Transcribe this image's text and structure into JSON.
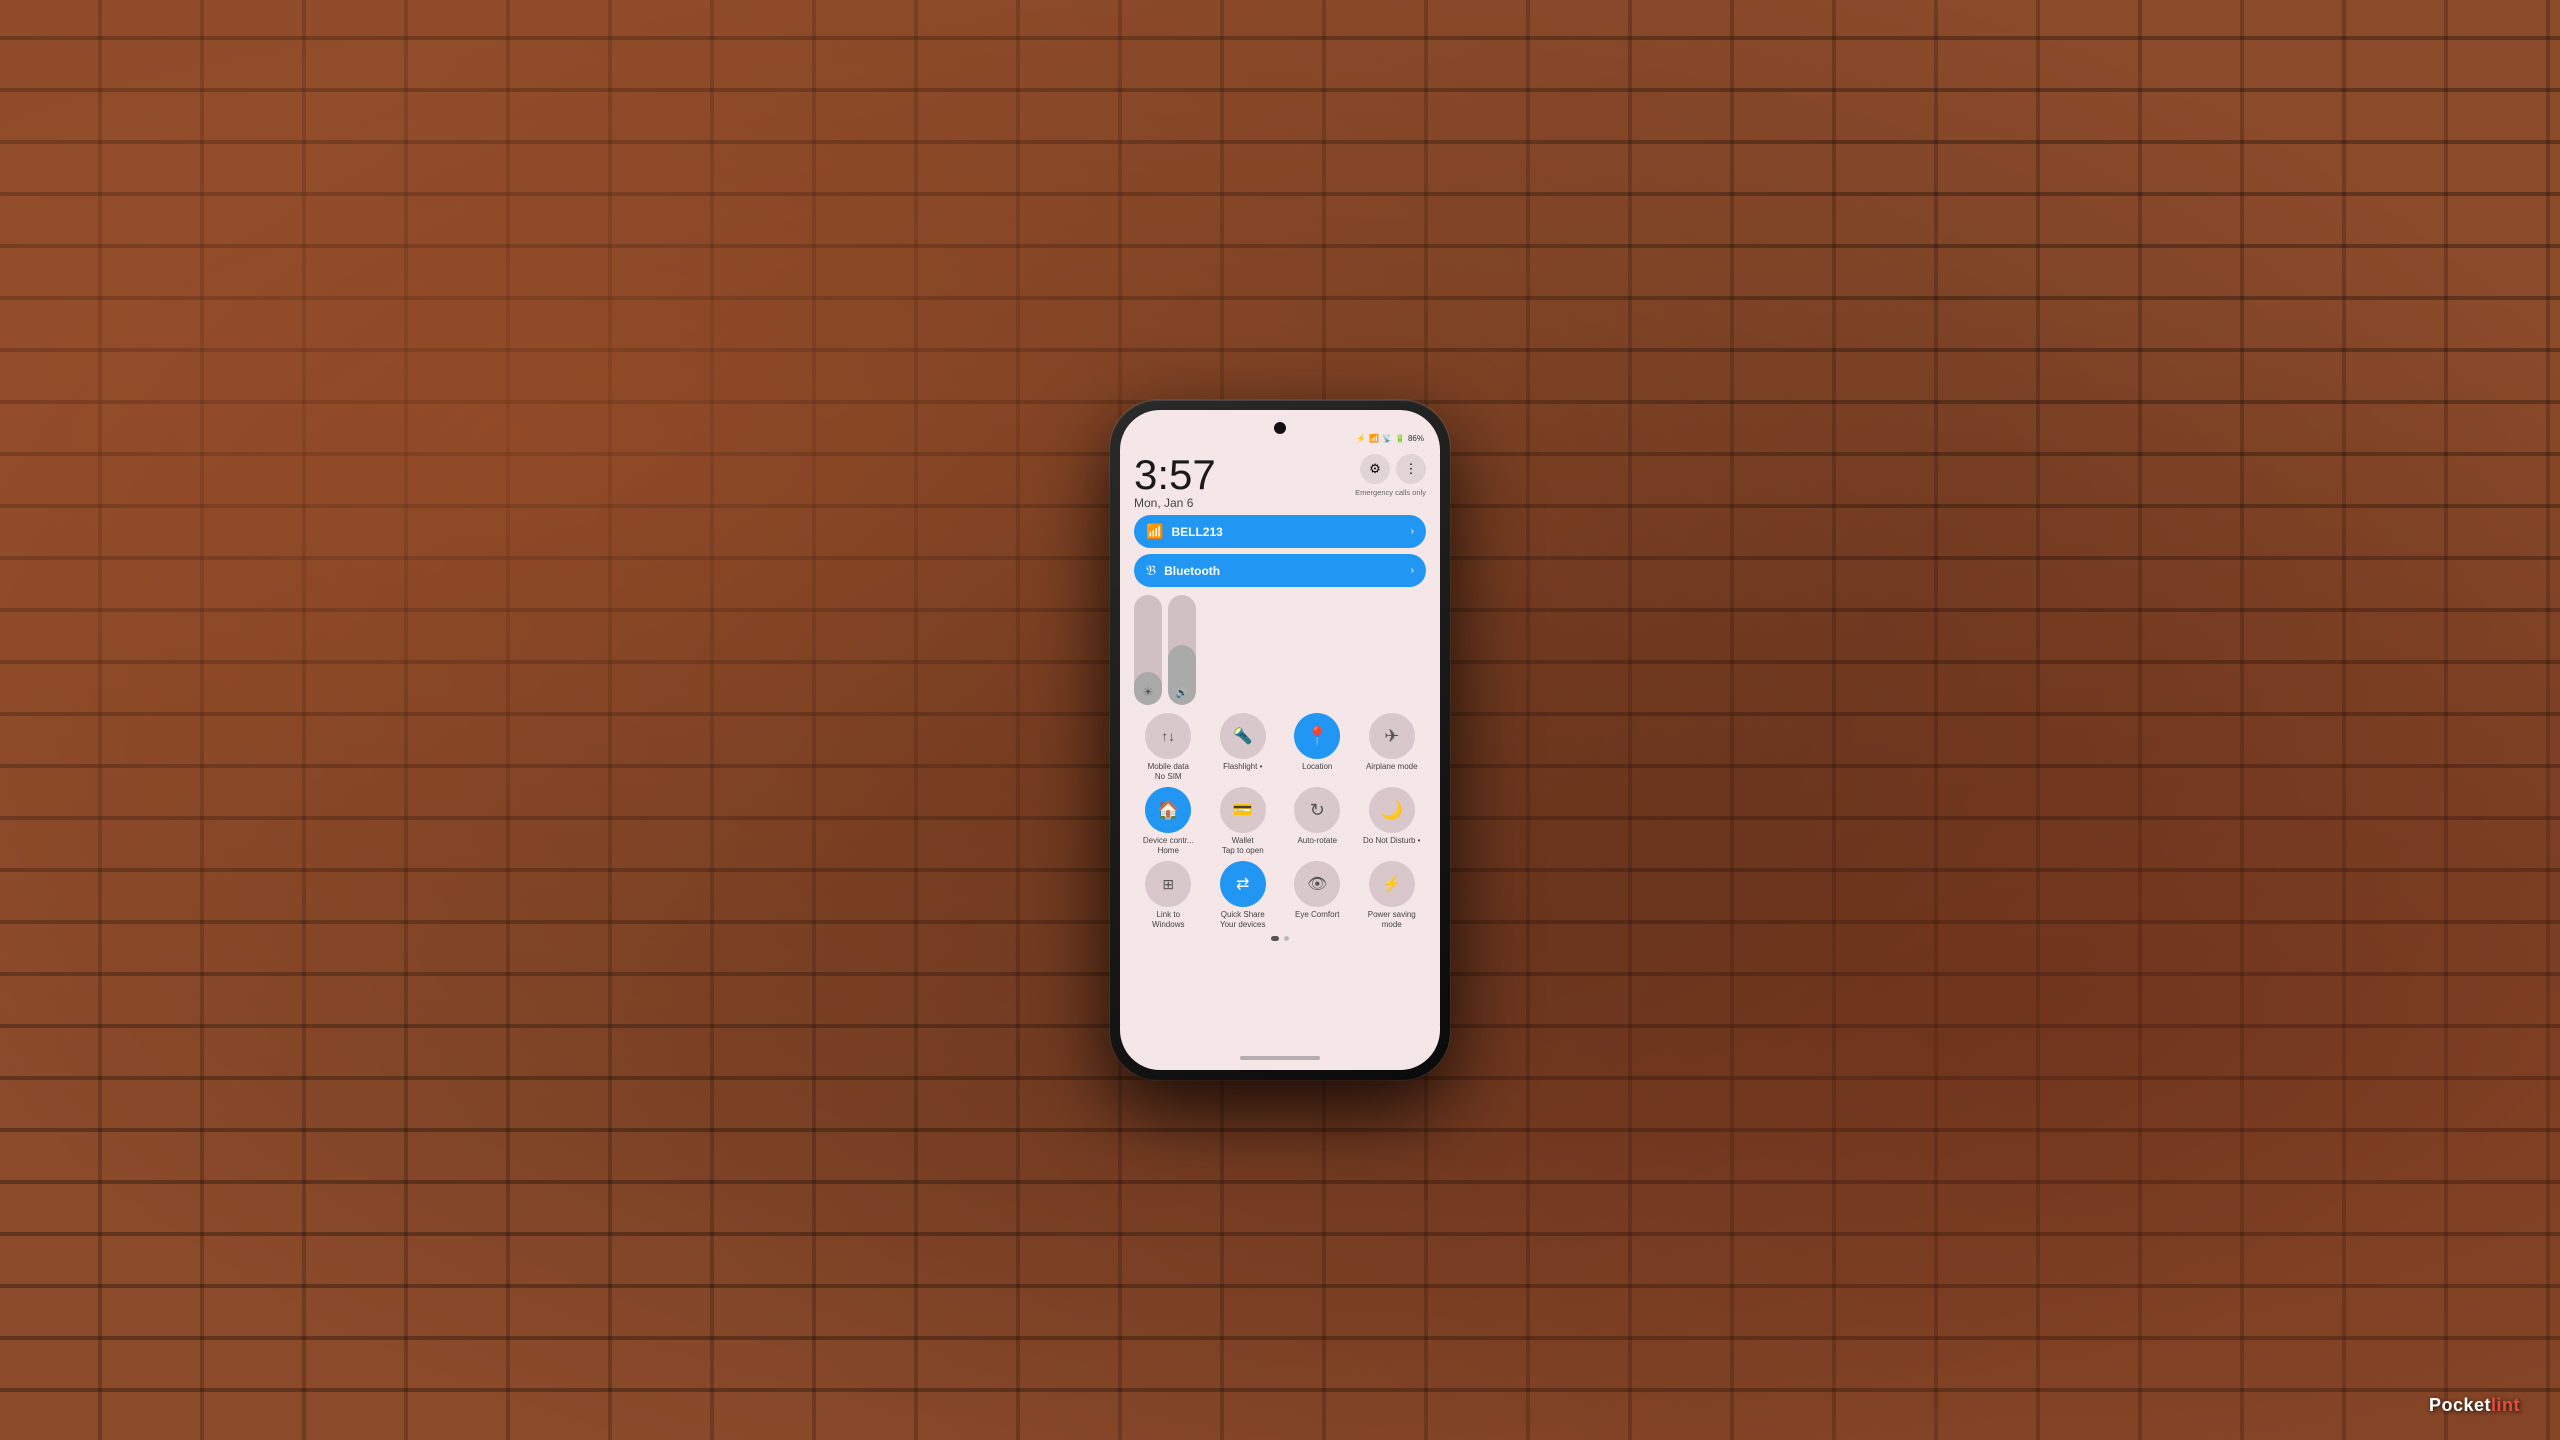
{
  "background": {
    "type": "brick_wall"
  },
  "watermark": {
    "text": "Pocketlint"
  },
  "phone": {
    "status_bar": {
      "time": "3:57",
      "icons": [
        "bluetooth",
        "wifi",
        "signal",
        "battery"
      ],
      "battery_percent": "86%",
      "emergency_text": "Emergency calls only"
    },
    "header": {
      "time": "3:57",
      "date": "Mon, Jan 6",
      "settings_icon": "⚙",
      "menu_icon": "⋮"
    },
    "network_tiles": [
      {
        "id": "wifi",
        "label": "BELL213",
        "active": true,
        "icon": "wifi"
      },
      {
        "id": "bluetooth",
        "label": "Bluetooth",
        "active": true,
        "icon": "bluetooth"
      }
    ],
    "sliders": [
      {
        "id": "brightness",
        "fill_percent": 30,
        "icon": "☀"
      },
      {
        "id": "volume",
        "fill_percent": 55,
        "icon": "🔊"
      }
    ],
    "tiles": [
      {
        "id": "mobile-data",
        "label": "Mobile data\nNo SIM",
        "icon": "↑↓",
        "active": false
      },
      {
        "id": "flashlight",
        "label": "Flashlight •",
        "icon": "🔦",
        "active": false
      },
      {
        "id": "location",
        "label": "Location",
        "icon": "📍",
        "active": true
      },
      {
        "id": "airplane-mode",
        "label": "Airplane mode",
        "icon": "✈",
        "active": false
      },
      {
        "id": "device-controls",
        "label": "Device contr...\nHome",
        "icon": "🏠",
        "active": true
      },
      {
        "id": "wallet",
        "label": "Wallet\nTap to open",
        "icon": "💳",
        "active": false
      },
      {
        "id": "auto-rotate",
        "label": "Auto-rotate",
        "icon": "↻",
        "active": false
      },
      {
        "id": "do-not-disturb",
        "label": "Do Not Disturb •",
        "icon": "🌙",
        "active": false
      },
      {
        "id": "link-to-windows",
        "label": "Link to\nWindows",
        "icon": "⊞",
        "active": false
      },
      {
        "id": "quick-share",
        "label": "Quick Share\nYour devices",
        "icon": "⇄",
        "active": true
      },
      {
        "id": "eye-comfort",
        "label": "Eye Comfort",
        "icon": "👁",
        "active": false
      },
      {
        "id": "power-saving",
        "label": "Power saving\nmode",
        "icon": "⚡",
        "active": false
      }
    ],
    "pagination": {
      "dots": [
        false,
        true
      ],
      "active_index": 0
    }
  }
}
